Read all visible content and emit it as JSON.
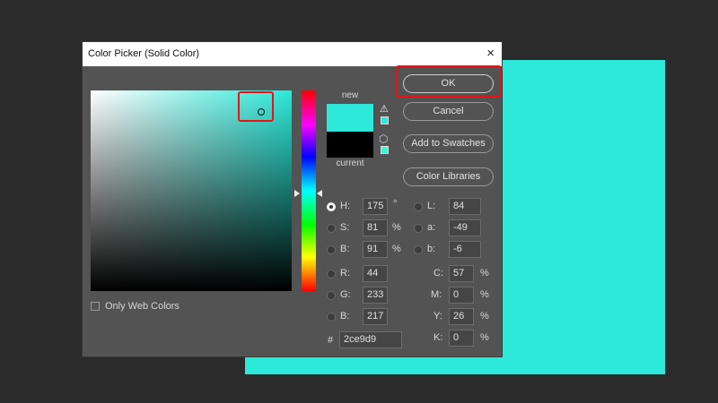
{
  "canvas": {
    "color": "#2ce9d9"
  },
  "dialog": {
    "title": "Color Picker (Solid Color)",
    "close_icon": "×",
    "field_hue_color": "#2ce9d9",
    "new_label": "new",
    "current_label": "current",
    "new_color": "#2ce9d9",
    "current_color": "#000000",
    "gamut_warning_icon": "⚠",
    "web_safe_icon": "⬡",
    "web_safe_color": "#33ffcc",
    "highlight_color": "#e0161b"
  },
  "buttons": {
    "ok": "OK",
    "cancel": "Cancel",
    "add_to_swatches": "Add to Swatches",
    "color_libraries": "Color Libraries"
  },
  "hsb": {
    "h": {
      "label": "H:",
      "value": "175",
      "unit": "°",
      "selected": true
    },
    "s": {
      "label": "S:",
      "value": "81",
      "unit": "%"
    },
    "b": {
      "label": "B:",
      "value": "91",
      "unit": "%"
    }
  },
  "rgb": {
    "r": {
      "label": "R:",
      "value": "44"
    },
    "g": {
      "label": "G:",
      "value": "233"
    },
    "b": {
      "label": "B:",
      "value": "217"
    }
  },
  "lab": {
    "l": {
      "label": "L:",
      "value": "84"
    },
    "a": {
      "label": "a:",
      "value": "-49"
    },
    "b": {
      "label": "b:",
      "value": "-6"
    }
  },
  "cmyk": {
    "c": {
      "label": "C:",
      "value": "57",
      "unit": "%"
    },
    "m": {
      "label": "M:",
      "value": "0",
      "unit": "%"
    },
    "y": {
      "label": "Y:",
      "value": "26",
      "unit": "%"
    },
    "k": {
      "label": "K:",
      "value": "0",
      "unit": "%"
    }
  },
  "hex": {
    "label": "#",
    "value": "2ce9d9"
  },
  "only_web_colors": {
    "label": "Only Web Colors",
    "checked": false
  }
}
